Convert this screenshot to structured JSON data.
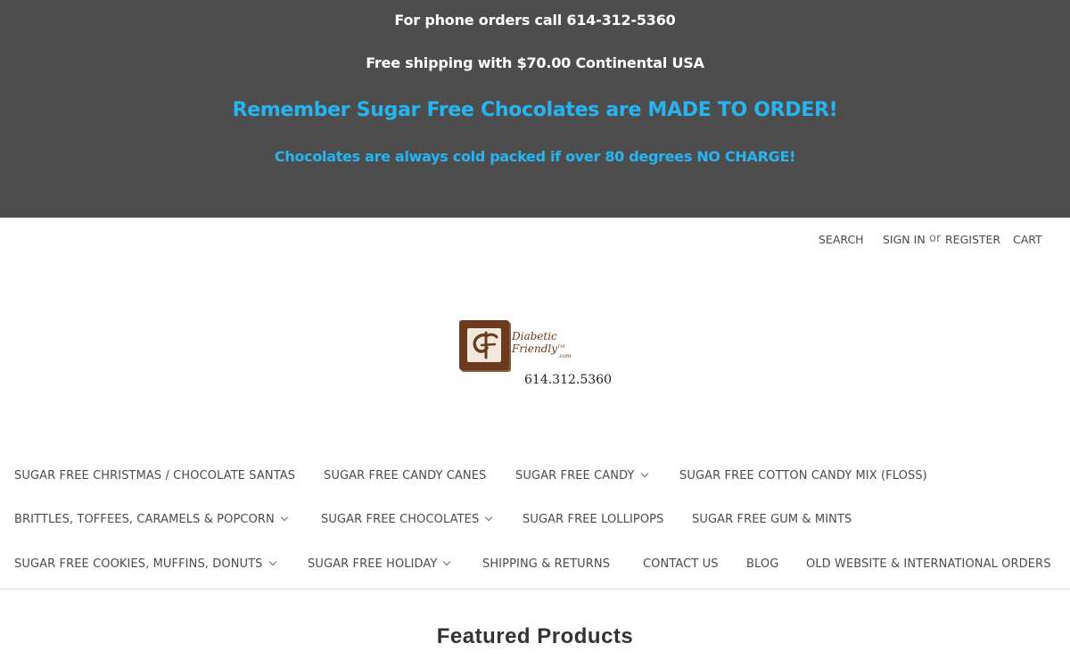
{
  "banner": {
    "line1": "For phone orders call 614-312-5360",
    "line2": "Free shipping with $70.00 Continental USA",
    "line3": "Remember Sugar Free Chocolates are MADE TO ORDER!",
    "line4": "Chocolates are always cold packed if over 80 degrees NO CHARGE!",
    "bg_color": "#4d4d4d",
    "accent_color": "#27b5f2"
  },
  "utility_nav": {
    "search": "Search",
    "sign_in": "Sign in",
    "or": "or",
    "register": "Register",
    "cart": "Cart"
  },
  "logo": {
    "name": "Diabetic Friendly",
    "tm": "TM",
    "domain": ".com",
    "phone": "614.312.5360"
  },
  "nav": {
    "rows": [
      [
        {
          "label": "Sugar Free Christmas / Chocolate Santas",
          "dropdown": false
        },
        {
          "label": "Sugar Free Candy Canes",
          "dropdown": false
        },
        {
          "label": "Sugar Free Candy",
          "dropdown": true
        },
        {
          "label": "Sugar Free Cotton Candy Mix (Floss)",
          "dropdown": false
        }
      ],
      [
        {
          "label": "Brittles, Toffees, Caramels & Popcorn",
          "dropdown": true
        },
        {
          "label": "Sugar Free Chocolates",
          "dropdown": true
        },
        {
          "label": "Sugar Free Lollipops",
          "dropdown": false
        },
        {
          "label": "Sugar Free Gum & Mints",
          "dropdown": false
        }
      ],
      [
        {
          "label": "Sugar Free Cookies, Muffins, Donuts",
          "dropdown": true
        },
        {
          "label": "Sugar Free Holiday",
          "dropdown": true
        },
        {
          "label": "Shipping & Returns",
          "dropdown": false
        },
        {
          "label": "Contact Us",
          "dropdown": false
        },
        {
          "label": "Blog",
          "dropdown": false
        },
        {
          "label": "Old Website & International Orders",
          "dropdown": false
        }
      ]
    ]
  },
  "main": {
    "heading": "Featured Products"
  }
}
